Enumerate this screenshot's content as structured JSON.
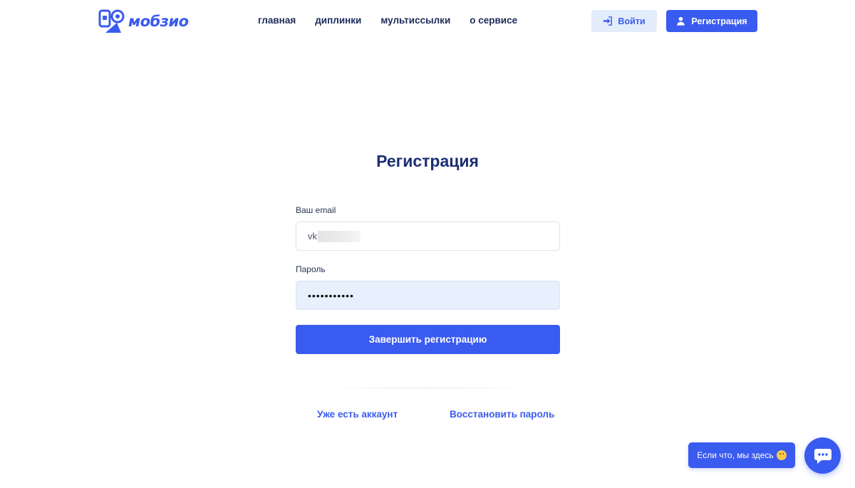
{
  "header": {
    "logo_text": "мобзио",
    "nav": [
      {
        "label": "главная"
      },
      {
        "label": "диплинки"
      },
      {
        "label": "мультиссылки"
      },
      {
        "label": "о сервисе"
      }
    ],
    "login_label": "Войти",
    "register_label": "Регистрация"
  },
  "form": {
    "title": "Регистрация",
    "email_label": "Ваш email",
    "email_value": "vk",
    "password_label": "Пароль",
    "password_value": "•••••••••••",
    "submit_label": "Завершить регистрацию"
  },
  "links": {
    "have_account": "Уже есть аккаунт",
    "restore_password": "Восстановить пароль"
  },
  "chat": {
    "bubble_text": "Если что, мы здесь"
  },
  "colors": {
    "accent": "#3a5bf0",
    "login_bg": "#e3ecfb",
    "title": "#1c2f73",
    "password_autofill_bg": "#e8f0fe"
  }
}
